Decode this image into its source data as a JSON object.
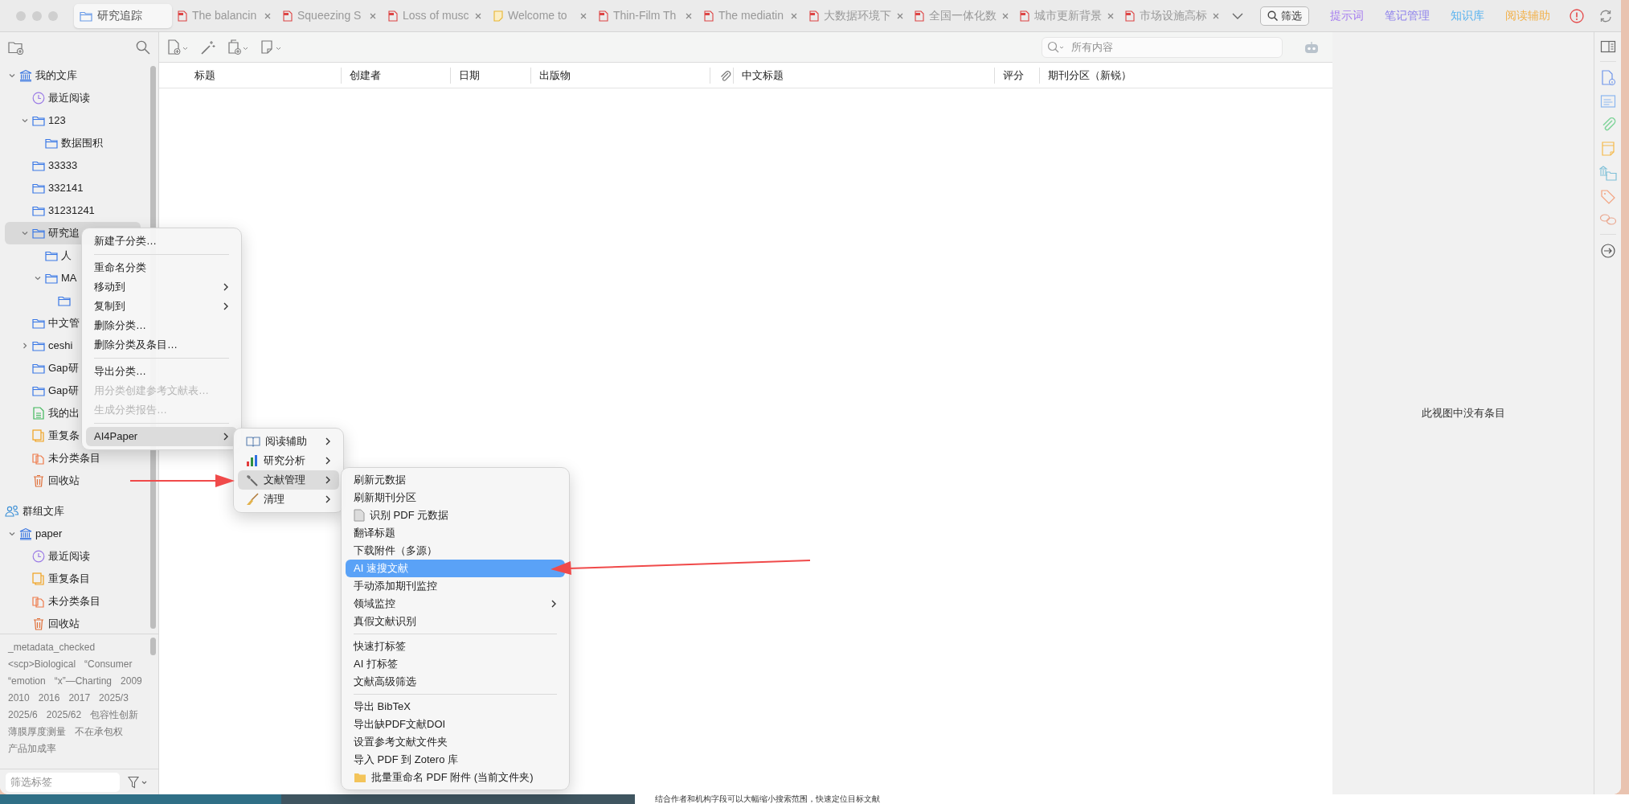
{
  "tabs": [
    {
      "label": "研究追踪",
      "kind": "collection",
      "selected": true
    },
    {
      "label": "The balancin",
      "kind": "pdf",
      "selected": false
    },
    {
      "label": "Squeezing S",
      "kind": "pdf",
      "selected": false
    },
    {
      "label": "Loss of musc",
      "kind": "pdf",
      "selected": false
    },
    {
      "label": "Welcome to",
      "kind": "note",
      "selected": false
    },
    {
      "label": "Thin-Film Th",
      "kind": "pdf",
      "selected": false
    },
    {
      "label": "The mediatin",
      "kind": "pdf",
      "selected": false
    },
    {
      "label": "大数据环境下",
      "kind": "pdf",
      "selected": false
    },
    {
      "label": "全国一体化数",
      "kind": "pdf",
      "selected": false
    },
    {
      "label": "城市更新背景",
      "kind": "pdf",
      "selected": false
    },
    {
      "label": "市场设施高标",
      "kind": "pdf",
      "selected": false
    }
  ],
  "filter_button": "筛选",
  "plugin_links": [
    {
      "label": "提示词",
      "color": "#a57cf0"
    },
    {
      "label": "笔记管理",
      "color": "#8f83ec"
    },
    {
      "label": "知识库",
      "color": "#59b3ef"
    },
    {
      "label": "阅读辅助",
      "color": "#f2b14a"
    }
  ],
  "sidebar": {
    "tree": [
      {
        "label": "我的文库",
        "kind": "library",
        "expanded": true,
        "selected": false,
        "children": [
          {
            "label": "最近阅读",
            "kind": "recent",
            "selected": false
          },
          {
            "label": "123",
            "kind": "folder",
            "expanded": true,
            "selected": false,
            "children": [
              {
                "label": "数据围积",
                "kind": "folder",
                "selected": false
              }
            ]
          },
          {
            "label": "33333",
            "kind": "folder",
            "selected": false
          },
          {
            "label": "332141",
            "kind": "folder",
            "selected": false
          },
          {
            "label": "31231241",
            "kind": "folder",
            "selected": false
          },
          {
            "label": "研究追",
            "kind": "folder",
            "expanded": true,
            "selected": true,
            "children": [
              {
                "label": "人",
                "kind": "folder",
                "selected": false
              },
              {
                "label": "MA",
                "kind": "folder",
                "expanded": true,
                "selected": false,
                "children": [
                  {
                    "kind": "folder",
                    "selected": false
                  }
                ]
              }
            ]
          },
          {
            "label": "中文管",
            "kind": "folder",
            "selected": false
          },
          {
            "label": "ceshi",
            "kind": "folder",
            "expanded": false,
            "selected": false
          },
          {
            "label": "Gap研",
            "kind": "folder",
            "selected": false
          },
          {
            "label": "Gap研",
            "kind": "folder",
            "selected": false
          },
          {
            "label": "我的出",
            "kind": "published",
            "selected": false
          },
          {
            "label": "重复条",
            "kind": "duplicates",
            "selected": false
          },
          {
            "label": "未分类条目",
            "kind": "unfiled",
            "selected": false
          },
          {
            "label": "回收站",
            "kind": "trash",
            "selected": false
          }
        ]
      },
      {
        "label": "群组文库",
        "kind": "group-header",
        "children": [
          {
            "label": "paper",
            "kind": "library",
            "expanded": true,
            "selected": false,
            "children": [
              {
                "label": "最近阅读",
                "kind": "recent",
                "selected": false
              },
              {
                "label": "重复条目",
                "kind": "duplicates",
                "selected": false
              },
              {
                "label": "未分类条目",
                "kind": "unfiled",
                "selected": false
              },
              {
                "label": "回收站",
                "kind": "trash",
                "selected": false
              }
            ]
          }
        ]
      }
    ],
    "tags": [
      "_metadata_checked",
      "<scp>Biological",
      "“Consumer",
      "“emotion",
      "“x”—Charting",
      "2009",
      "2010",
      "2016",
      "2017",
      "2025/3",
      "2025/6",
      "2025/62",
      "包容性创新",
      "薄膜厚度测量",
      "不在承包权",
      "产品加成率"
    ],
    "tag_filter": {
      "placeholder": "筛选标签"
    }
  },
  "search": {
    "placeholder": "所有内容"
  },
  "table": {
    "columns": [
      {
        "label": "标题"
      },
      {
        "label": "创建者"
      },
      {
        "label": "日期"
      },
      {
        "label": "出版物"
      },
      {
        "kind": "attachment"
      },
      {
        "label": "中文标题"
      },
      {
        "label": "评分"
      },
      {
        "label": "期刊分区（新锐）"
      }
    ]
  },
  "item_pane": {
    "message": "此视图中没有条目"
  },
  "context_menu": {
    "items": [
      {
        "kind": "item",
        "label": "新建子分类…",
        "submenu": false,
        "disabled": false,
        "selected": false
      },
      {
        "kind": "separator"
      },
      {
        "kind": "item",
        "label": "重命名分类",
        "submenu": false,
        "disabled": false,
        "selected": false
      },
      {
        "kind": "item",
        "label": "移动到",
        "submenu": true,
        "disabled": false,
        "selected": false
      },
      {
        "kind": "item",
        "label": "复制到",
        "submenu": true,
        "disabled": false,
        "selected": false
      },
      {
        "kind": "item",
        "label": "删除分类…",
        "submenu": false,
        "disabled": false,
        "selected": false
      },
      {
        "kind": "item",
        "label": "删除分类及条目…",
        "submenu": false,
        "disabled": false,
        "selected": false
      },
      {
        "kind": "separator"
      },
      {
        "kind": "item",
        "label": "导出分类…",
        "submenu": false,
        "disabled": false,
        "selected": false
      },
      {
        "kind": "item",
        "label": "用分类创建参考文献表…",
        "submenu": false,
        "disabled": true,
        "selected": false
      },
      {
        "kind": "item",
        "label": "生成分类报告…",
        "submenu": false,
        "disabled": true,
        "selected": false
      },
      {
        "kind": "separator"
      },
      {
        "kind": "item",
        "label": "AI4Paper",
        "submenu": true,
        "disabled": false,
        "selected": true
      }
    ]
  },
  "ai4paper_menu": {
    "items": [
      {
        "kind": "item",
        "label": "阅读辅助",
        "submenu": true,
        "selected": false
      },
      {
        "kind": "item",
        "label": "研究分析",
        "submenu": true,
        "selected": false
      },
      {
        "kind": "item",
        "label": "文献管理",
        "submenu": true,
        "selected": true
      },
      {
        "kind": "item",
        "label": "清理",
        "submenu": true,
        "selected": false
      }
    ]
  },
  "manage_menu": {
    "items": [
      {
        "kind": "item",
        "label": "刷新元数据",
        "submenu": false,
        "selected": false
      },
      {
        "kind": "item",
        "label": "刷新期刊分区",
        "submenu": false,
        "selected": false
      },
      {
        "kind": "item",
        "label": "识别 PDF 元数据",
        "submenu": false,
        "selected": false
      },
      {
        "kind": "item",
        "label": "翻译标题",
        "submenu": false,
        "selected": false
      },
      {
        "kind": "item",
        "label": "下载附件（多源）",
        "submenu": false,
        "selected": false
      },
      {
        "kind": "item",
        "label": "AI 速搜文献",
        "submenu": false,
        "selected": true
      },
      {
        "kind": "item",
        "label": "手动添加期刊监控",
        "submenu": false,
        "selected": false
      },
      {
        "kind": "item",
        "label": "领域监控",
        "submenu": true,
        "selected": false
      },
      {
        "kind": "item",
        "label": "真假文献识别",
        "submenu": false,
        "selected": false
      },
      {
        "kind": "separator"
      },
      {
        "kind": "item",
        "label": "快速打标签",
        "submenu": false,
        "selected": false
      },
      {
        "kind": "item",
        "label": "AI 打标签",
        "submenu": false,
        "selected": false
      },
      {
        "kind": "item",
        "label": "文献高级筛选",
        "submenu": false,
        "selected": false
      },
      {
        "kind": "separator"
      },
      {
        "kind": "item",
        "label": "导出 BibTeX",
        "submenu": false,
        "selected": false
      },
      {
        "kind": "item",
        "label": "导出缺PDF文献DOI",
        "submenu": false,
        "selected": false
      },
      {
        "kind": "item",
        "label": "设置参考文献文件夹",
        "submenu": false,
        "selected": false
      },
      {
        "kind": "item",
        "label": "导入 PDF 到 Zotero 库",
        "submenu": false,
        "selected": false
      },
      {
        "kind": "item",
        "label": "批量重命名 PDF 附件 (当前文件夹)",
        "submenu": false,
        "selected": false
      }
    ]
  },
  "background_text": "结合作者和机构字段可以大幅缩小搜索范围，快速定位目标文献"
}
